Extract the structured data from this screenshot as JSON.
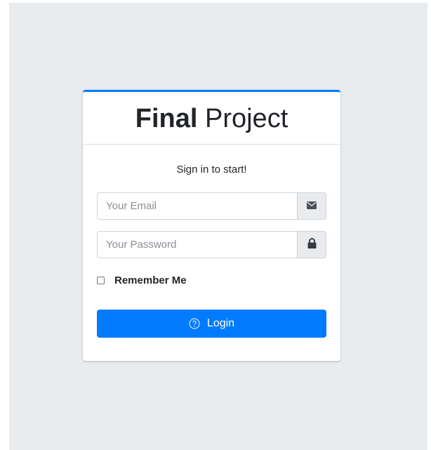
{
  "brand": {
    "bold": "Final",
    "light": "Project"
  },
  "form": {
    "subtitle": "Sign in to start!",
    "email_placeholder": "Your Email",
    "password_placeholder": "Your Password",
    "remember_label": "Remember Me",
    "login_label": "Login"
  },
  "icons": {
    "email": "envelope-icon",
    "password": "lock-icon",
    "login": "question-circle-icon"
  },
  "colors": {
    "accent": "#007bff",
    "background": "#e9ecef"
  }
}
